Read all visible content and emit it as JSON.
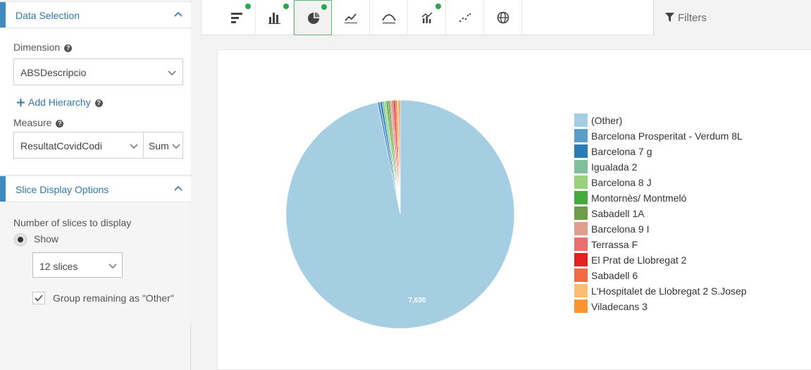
{
  "data_selection": {
    "title": "Data Selection",
    "dimension_label": "Dimension",
    "dimension_value": "ABSDescripcio",
    "add_hierarchy_label": "Add Hierarchy",
    "measure_label": "Measure",
    "measure_value": "ResultatCovidCodi",
    "aggregation_value": "Sum"
  },
  "slice_options": {
    "title": "Slice Display Options",
    "num_slices_label": "Number of slices to display",
    "show_label": "Show",
    "slices_value": "12 slices",
    "group_other_label": "Group remaining as \"Other\"",
    "group_other_checked": true
  },
  "toolbar": {
    "buttons": [
      {
        "icon": "horizontal-bar-chart-icon",
        "has_dot": true
      },
      {
        "icon": "bar-chart-icon",
        "has_dot": true
      },
      {
        "icon": "pie-chart-icon",
        "has_dot": true,
        "active": true
      },
      {
        "icon": "line-chart-icon",
        "has_dot": false
      },
      {
        "icon": "area-chart-icon",
        "has_dot": false
      },
      {
        "icon": "combo-chart-icon",
        "has_dot": true
      },
      {
        "icon": "scatter-chart-icon",
        "has_dot": false
      },
      {
        "icon": "globe-map-icon",
        "has_dot": false
      }
    ],
    "filters_label": "Filters"
  },
  "colors": {
    "accent": "#3f8bbd",
    "active_dot": "#2aa84a"
  },
  "chart_data": {
    "type": "pie",
    "categories": [
      "(Other)",
      "Barcelona Prosperitat - Verdum 8L",
      "Barcelona 7 g",
      "Igualada 2",
      "Barcelona 8 J",
      "Montornès/ Montmeló",
      "Sabadell 1A",
      "Barcelona 9 I",
      "Terrassa F",
      "El Prat de Llobregat 2",
      "Sabadell 6",
      "L'Hospitalet de Llobregat 2 S.Josep",
      "Viladecans 3"
    ],
    "values": [
      7630,
      30,
      24,
      22,
      21,
      21,
      21,
      20,
      20,
      19,
      19,
      19,
      18
    ],
    "colors": [
      "#a6cee3",
      "#5b9cc8",
      "#2b7bb4",
      "#7fbf9a",
      "#98d27a",
      "#44ab3e",
      "#6f9c49",
      "#e09f8e",
      "#ec6f6f",
      "#e42121",
      "#ef6a45",
      "#fbbd72",
      "#fb9530"
    ],
    "data_labels": [
      "7,630"
    ],
    "legend_position": "right"
  }
}
